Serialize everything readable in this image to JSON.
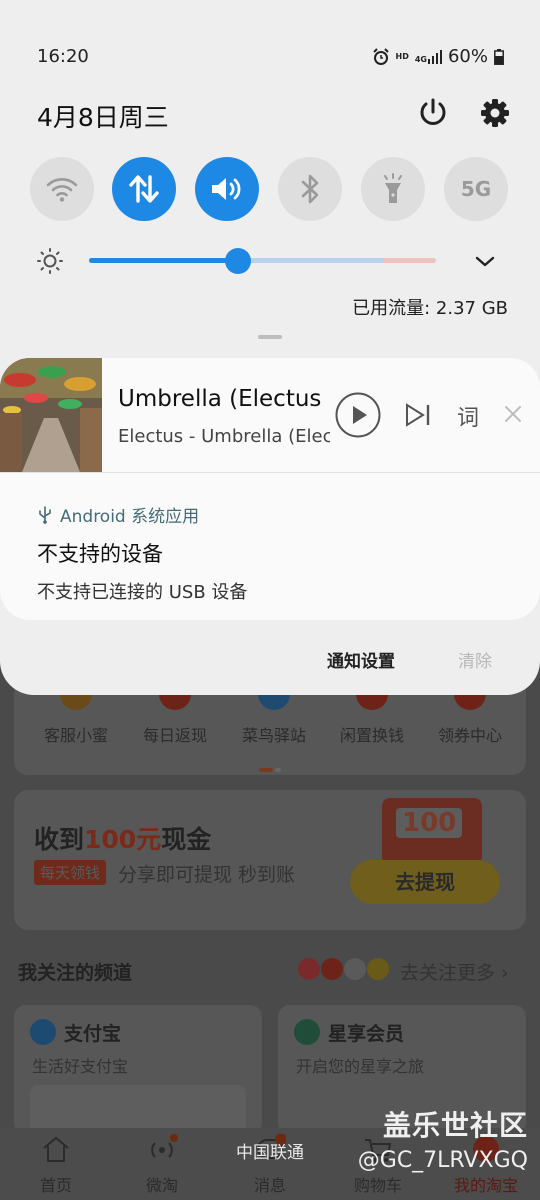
{
  "status_bar": {
    "time": "16:20",
    "net_hd": "HD",
    "net_4g": "4G",
    "battery": "60%"
  },
  "header": {
    "date": "4月8日周三"
  },
  "quick_settings": {
    "tiles": [
      {
        "name": "wifi",
        "state": "off"
      },
      {
        "name": "mobile-data",
        "state": "on"
      },
      {
        "name": "sound",
        "state": "on"
      },
      {
        "name": "bluetooth",
        "state": "off"
      },
      {
        "name": "flashlight",
        "state": "off"
      },
      {
        "name": "5g",
        "state": "off",
        "label": "5G"
      }
    ],
    "brightness_level": 0.43,
    "data_usage": "已用流量: 2.37 GB"
  },
  "media": {
    "title": "Umbrella (Electus Remix)",
    "artist": "Electus - Umbrella (Electus Remix)",
    "lyrics_label": "词"
  },
  "notification": {
    "app": "Android 系统应用",
    "title": "不支持的设备",
    "body": "不支持已连接的 USB 设备"
  },
  "shade_actions": {
    "settings": "通知设置",
    "clear": "清除"
  },
  "background_app": {
    "shortcuts": [
      "客服小蜜",
      "每日返现",
      "菜鸟驿站",
      "闲置换钱",
      "领券中心"
    ],
    "cash": {
      "title_pre": "收到",
      "title_amount": "100元",
      "title_post": "现金",
      "tag": "每天领钱",
      "subtitle": "分享即可提现 秒到账",
      "box_number": "100",
      "button": "去提现"
    },
    "channels": {
      "title": "我关注的频道",
      "more": "去关注更多 ›",
      "cards": [
        {
          "title": "支付宝",
          "subtitle": "生活好支付宝"
        },
        {
          "title": "星享会员",
          "subtitle": "开启您的星享之旅"
        }
      ]
    },
    "tabs": [
      "首页",
      "微淘",
      "消息",
      "购物车",
      "我的淘宝"
    ]
  },
  "carrier": "中国联通",
  "watermark": {
    "line1": "盖乐世社区",
    "line2": "@GC_7LRVXGQ"
  },
  "colors": {
    "accent": "#1e88e5",
    "shade_bg": "#eeeeee",
    "card_bg": "#fafafa"
  }
}
